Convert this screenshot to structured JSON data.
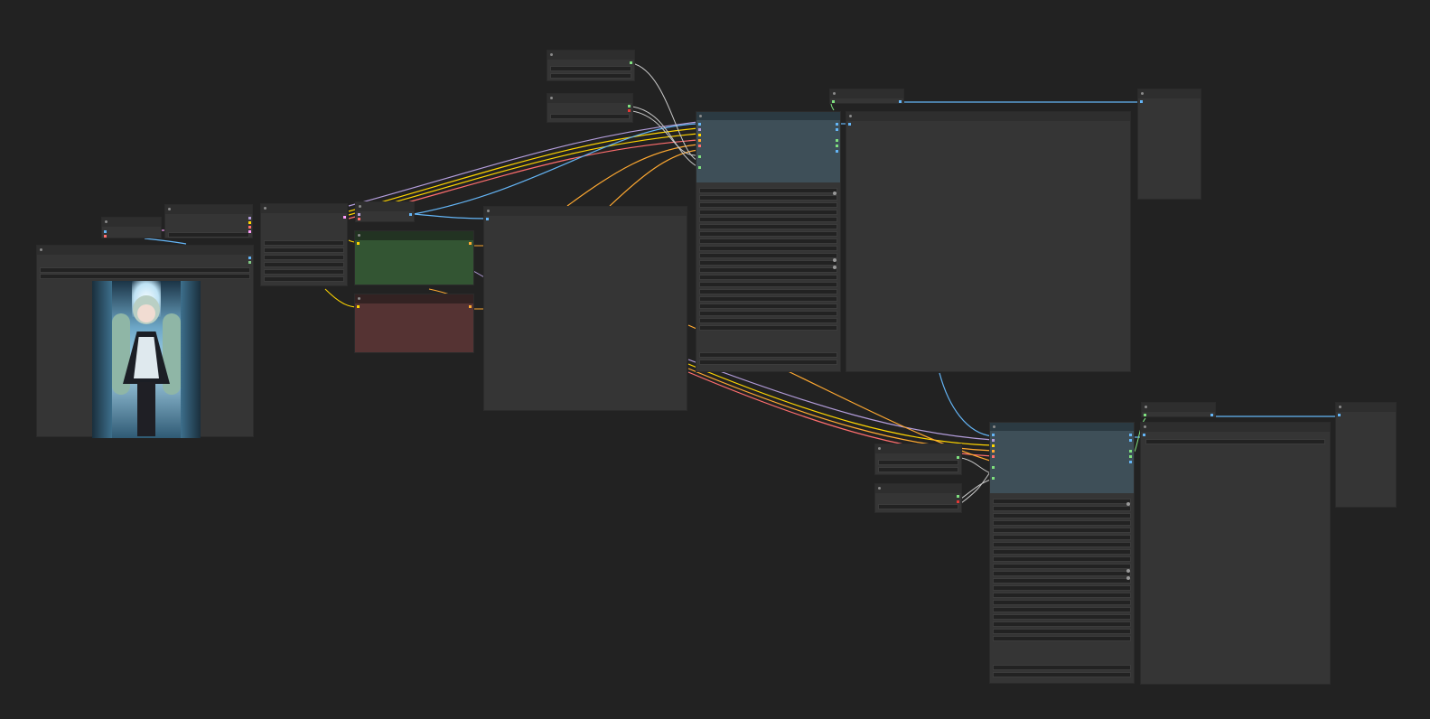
{
  "colors": {
    "canvas_bg": "#222222",
    "node_bg": "#353535",
    "node_title": "#2e2e2e",
    "ksampler_title": "#2b3a42",
    "ksampler_head": "#3e4f58",
    "ksampler_body": "#353535",
    "positive_prompt_body": "#335533",
    "positive_prompt_title": "#223322",
    "negative_prompt_body": "#553333",
    "negative_prompt_title": "#332222",
    "link_model": "#b39ddb",
    "link_clip": "#ffd500",
    "link_vae": "#ff6e6e",
    "link_conditioning": "#ffa931",
    "link_latent": "#ff9cf9",
    "link_image": "#64b5f6",
    "link_int": "#7fe07f",
    "link_float": "#c8c8c8"
  },
  "graph": {
    "nodes": [
      "load-image",
      "load-checkpoint",
      "clip-skip",
      "vae-encode",
      "positive-prompt",
      "negative-prompt",
      "preview-large",
      "ksampler-1",
      "vae-decode-1",
      "save-image-1",
      "ksampler-2",
      "vae-decode-2",
      "save-image-2"
    ],
    "node_image": "anime-maid-girl-portrait"
  }
}
